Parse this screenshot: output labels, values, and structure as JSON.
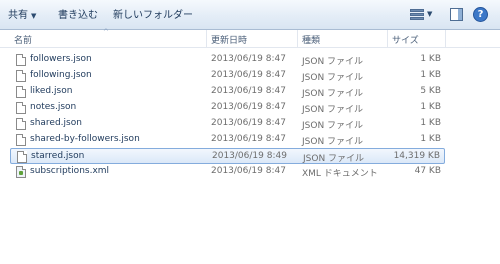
{
  "toolbar": {
    "share_label": "共有",
    "burn_label": "書き込む",
    "new_folder_label": "新しいフォルダー",
    "help_glyph": "?",
    "icons": [
      "view-options-icon",
      "chevron-down-icon",
      "preview-pane-icon",
      "help-icon"
    ]
  },
  "columns": {
    "name": "名前",
    "date": "更新日時",
    "type": "種類",
    "size": "サイズ"
  },
  "files": [
    {
      "name": "followers.json",
      "date": "2013/06/19 8:47",
      "type": "JSON ファイル",
      "size": "1 KB"
    },
    {
      "name": "following.json",
      "date": "2013/06/19 8:47",
      "type": "JSON ファイル",
      "size": "1 KB"
    },
    {
      "name": "liked.json",
      "date": "2013/06/19 8:47",
      "type": "JSON ファイル",
      "size": "5 KB"
    },
    {
      "name": "notes.json",
      "date": "2013/06/19 8:47",
      "type": "JSON ファイル",
      "size": "1 KB"
    },
    {
      "name": "shared.json",
      "date": "2013/06/19 8:47",
      "type": "JSON ファイル",
      "size": "1 KB"
    },
    {
      "name": "shared-by-followers.json",
      "date": "2013/06/19 8:47",
      "type": "JSON ファイル",
      "size": "1 KB"
    },
    {
      "name": "starred.json",
      "date": "2013/06/19 8:49",
      "type": "JSON ファイル",
      "size": "14,319 KB",
      "selected": true
    },
    {
      "name": "subscriptions.xml",
      "date": "2013/06/19 8:47",
      "type": "XML ドキュメント",
      "size": "47 KB"
    }
  ],
  "colors": {
    "selection_border": "#84acdd",
    "selection_fill": "#dbe8f8",
    "toolbar_bg": "#e4edf7",
    "text": "#1e395b"
  }
}
